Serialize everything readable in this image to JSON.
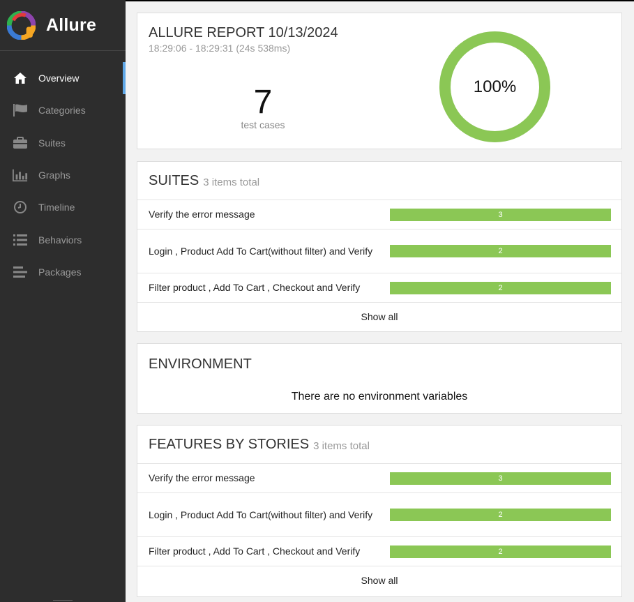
{
  "brand": {
    "name": "Allure"
  },
  "nav": [
    {
      "label": "Overview",
      "icon": "home-icon",
      "active": true
    },
    {
      "label": "Categories",
      "icon": "flag-icon"
    },
    {
      "label": "Suites",
      "icon": "briefcase-icon"
    },
    {
      "label": "Graphs",
      "icon": "bar-chart-icon"
    },
    {
      "label": "Timeline",
      "icon": "clock-icon"
    },
    {
      "label": "Behaviors",
      "icon": "list-icon"
    },
    {
      "label": "Packages",
      "icon": "align-left-icon"
    }
  ],
  "summary": {
    "title": "ALLURE REPORT 10/13/2024",
    "time": "18:29:06 - 18:29:31 (24s 538ms)",
    "count": "7",
    "count_label": "test cases",
    "percent": "100%",
    "pass_fraction": 1.0,
    "pass_color": "#8bc755"
  },
  "suites": {
    "title": "SUITES",
    "count": "3 items total",
    "rows": [
      {
        "name": "Verify the error message",
        "value": "3"
      },
      {
        "name": "Login , Product Add To Cart(without filter) and Verify",
        "value": "2"
      },
      {
        "name": "Filter product , Add To Cart , Checkout and Verify",
        "value": "2"
      }
    ],
    "show_all": "Show all"
  },
  "environment": {
    "title": "ENVIRONMENT",
    "empty": "There are no environment variables"
  },
  "features": {
    "title": "FEATURES BY STORIES",
    "count": "3 items total",
    "rows": [
      {
        "name": "Verify the error message",
        "value": "3"
      },
      {
        "name": "Login , Product Add To Cart(without filter) and Verify",
        "value": "2"
      },
      {
        "name": "Filter product , Add To Cart , Checkout and Verify",
        "value": "2"
      }
    ],
    "show_all": "Show all"
  }
}
